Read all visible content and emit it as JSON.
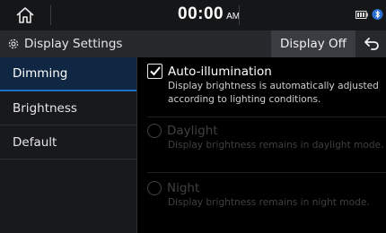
{
  "statusbar": {
    "time": "00:00",
    "ampm": "AM"
  },
  "header": {
    "title": "Display Settings",
    "display_off_label": "Display Off"
  },
  "sidebar": {
    "items": [
      {
        "label": "Dimming"
      },
      {
        "label": "Brightness"
      },
      {
        "label": "Default"
      }
    ]
  },
  "options": {
    "auto": {
      "label": "Auto-illumination",
      "desc1": "Display brightness is automatically adjusted",
      "desc2": "according to lighting conditions."
    },
    "daylight": {
      "label": "Daylight",
      "desc": "Display brightness remains in daylight mode."
    },
    "night": {
      "label": "Night",
      "desc": "Display brightness remains in night mode."
    }
  },
  "colors": {
    "accent_blue": "#1f6ec8",
    "active_bg": "#0f2742",
    "disabled_text": "#3e4044"
  },
  "icons": [
    "home-icon",
    "gear-icon",
    "back-icon",
    "battery-icon",
    "bluetooth-icon",
    "signal-icon",
    "checkmark-icon"
  ]
}
